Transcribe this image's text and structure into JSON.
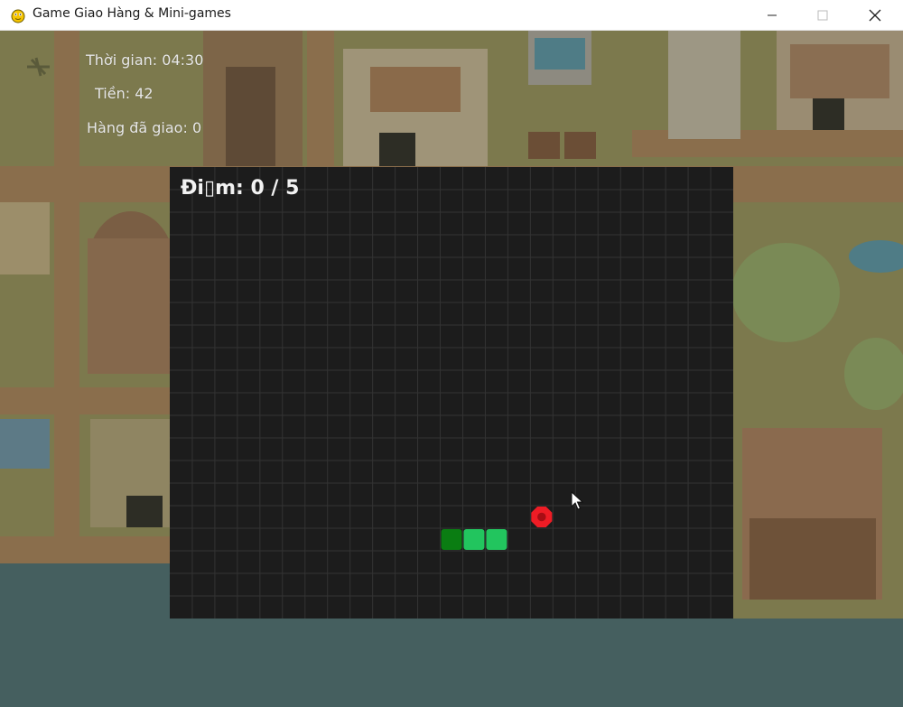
{
  "window": {
    "title": "Game Giao Hàng & Mini-games",
    "minimize_icon": "minimize-icon",
    "maximize_icon": "maximize-icon",
    "close_icon": "close-icon"
  },
  "hud": {
    "time_text": "Thời gian: 04:30",
    "money_text": "Tiền: 42",
    "delivered_text": "Hàng đã giao: 0"
  },
  "minigame": {
    "score_text": "Đi▯m: 0 / 5",
    "grid_columns": 25,
    "grid_rows": 20,
    "snake": {
      "head_color": "#0a7d12",
      "body_color": "#22c55e",
      "segments": [
        [
          12,
          16
        ],
        [
          13,
          16
        ],
        [
          14,
          16
        ]
      ]
    },
    "food": {
      "color": "#ee1c25",
      "cell": [
        16,
        15
      ]
    }
  },
  "colors": {
    "board_background": "#1c1c1c",
    "grid_line": "#333333",
    "water": "#435f61"
  }
}
